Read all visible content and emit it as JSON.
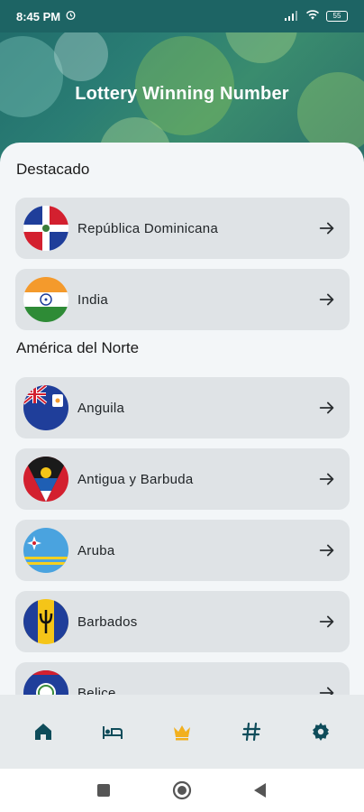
{
  "status_bar": {
    "time": "8:45 PM",
    "battery": "55"
  },
  "app": {
    "title": "Lottery Winning Number"
  },
  "sections": [
    {
      "title": "Destacado",
      "items": [
        {
          "label": "República Dominicana",
          "flag": "dominican-republic-flag"
        },
        {
          "label": "India",
          "flag": "india-flag"
        }
      ]
    },
    {
      "title": "América del Norte",
      "items": [
        {
          "label": "Anguila",
          "flag": "anguilla-flag"
        },
        {
          "label": "Antigua y Barbuda",
          "flag": "antigua-barbuda-flag"
        },
        {
          "label": "Aruba",
          "flag": "aruba-flag"
        },
        {
          "label": "Barbados",
          "flag": "barbados-flag"
        },
        {
          "label": "Belice",
          "flag": "belize-flag"
        }
      ]
    }
  ],
  "bottom_nav": [
    {
      "icon": "home-icon",
      "active": false
    },
    {
      "icon": "bed-icon",
      "active": false
    },
    {
      "icon": "crown-icon",
      "active": true
    },
    {
      "icon": "hash-icon",
      "active": false
    },
    {
      "icon": "gear-icon",
      "active": false
    }
  ],
  "colors": {
    "active": "#f2b01e",
    "inactive": "#0e4c5a",
    "header": "#1f6a6a"
  }
}
